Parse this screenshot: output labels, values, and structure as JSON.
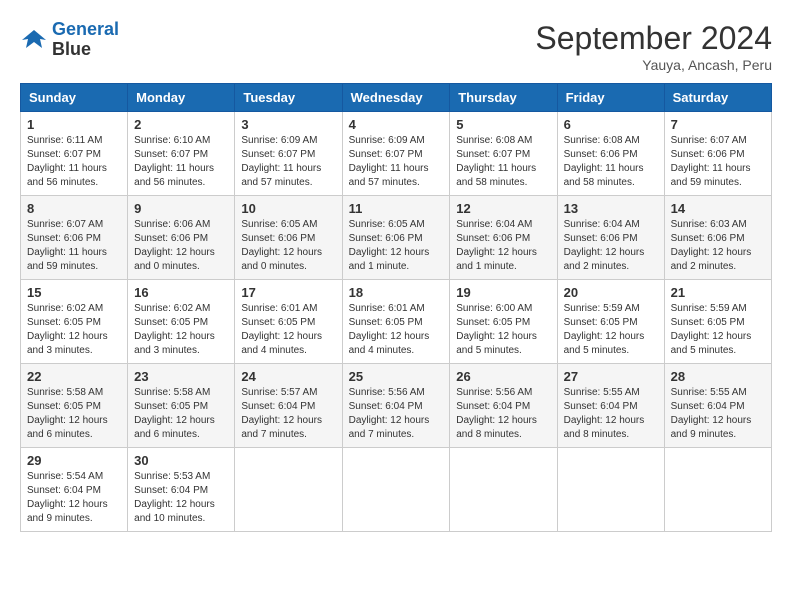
{
  "logo": {
    "line1": "General",
    "line2": "Blue"
  },
  "title": "September 2024",
  "location": "Yauya, Ancash, Peru",
  "days_of_week": [
    "Sunday",
    "Monday",
    "Tuesday",
    "Wednesday",
    "Thursday",
    "Friday",
    "Saturday"
  ],
  "weeks": [
    [
      {
        "day": "1",
        "sunrise": "6:11 AM",
        "sunset": "6:07 PM",
        "daylight": "11 hours and 56 minutes."
      },
      {
        "day": "2",
        "sunrise": "6:10 AM",
        "sunset": "6:07 PM",
        "daylight": "11 hours and 56 minutes."
      },
      {
        "day": "3",
        "sunrise": "6:09 AM",
        "sunset": "6:07 PM",
        "daylight": "11 hours and 57 minutes."
      },
      {
        "day": "4",
        "sunrise": "6:09 AM",
        "sunset": "6:07 PM",
        "daylight": "11 hours and 57 minutes."
      },
      {
        "day": "5",
        "sunrise": "6:08 AM",
        "sunset": "6:07 PM",
        "daylight": "11 hours and 58 minutes."
      },
      {
        "day": "6",
        "sunrise": "6:08 AM",
        "sunset": "6:06 PM",
        "daylight": "11 hours and 58 minutes."
      },
      {
        "day": "7",
        "sunrise": "6:07 AM",
        "sunset": "6:06 PM",
        "daylight": "11 hours and 59 minutes."
      }
    ],
    [
      {
        "day": "8",
        "sunrise": "6:07 AM",
        "sunset": "6:06 PM",
        "daylight": "11 hours and 59 minutes."
      },
      {
        "day": "9",
        "sunrise": "6:06 AM",
        "sunset": "6:06 PM",
        "daylight": "12 hours and 0 minutes."
      },
      {
        "day": "10",
        "sunrise": "6:05 AM",
        "sunset": "6:06 PM",
        "daylight": "12 hours and 0 minutes."
      },
      {
        "day": "11",
        "sunrise": "6:05 AM",
        "sunset": "6:06 PM",
        "daylight": "12 hours and 1 minute."
      },
      {
        "day": "12",
        "sunrise": "6:04 AM",
        "sunset": "6:06 PM",
        "daylight": "12 hours and 1 minute."
      },
      {
        "day": "13",
        "sunrise": "6:04 AM",
        "sunset": "6:06 PM",
        "daylight": "12 hours and 2 minutes."
      },
      {
        "day": "14",
        "sunrise": "6:03 AM",
        "sunset": "6:06 PM",
        "daylight": "12 hours and 2 minutes."
      }
    ],
    [
      {
        "day": "15",
        "sunrise": "6:02 AM",
        "sunset": "6:05 PM",
        "daylight": "12 hours and 3 minutes."
      },
      {
        "day": "16",
        "sunrise": "6:02 AM",
        "sunset": "6:05 PM",
        "daylight": "12 hours and 3 minutes."
      },
      {
        "day": "17",
        "sunrise": "6:01 AM",
        "sunset": "6:05 PM",
        "daylight": "12 hours and 4 minutes."
      },
      {
        "day": "18",
        "sunrise": "6:01 AM",
        "sunset": "6:05 PM",
        "daylight": "12 hours and 4 minutes."
      },
      {
        "day": "19",
        "sunrise": "6:00 AM",
        "sunset": "6:05 PM",
        "daylight": "12 hours and 5 minutes."
      },
      {
        "day": "20",
        "sunrise": "5:59 AM",
        "sunset": "6:05 PM",
        "daylight": "12 hours and 5 minutes."
      },
      {
        "day": "21",
        "sunrise": "5:59 AM",
        "sunset": "6:05 PM",
        "daylight": "12 hours and 5 minutes."
      }
    ],
    [
      {
        "day": "22",
        "sunrise": "5:58 AM",
        "sunset": "6:05 PM",
        "daylight": "12 hours and 6 minutes."
      },
      {
        "day": "23",
        "sunrise": "5:58 AM",
        "sunset": "6:05 PM",
        "daylight": "12 hours and 6 minutes."
      },
      {
        "day": "24",
        "sunrise": "5:57 AM",
        "sunset": "6:04 PM",
        "daylight": "12 hours and 7 minutes."
      },
      {
        "day": "25",
        "sunrise": "5:56 AM",
        "sunset": "6:04 PM",
        "daylight": "12 hours and 7 minutes."
      },
      {
        "day": "26",
        "sunrise": "5:56 AM",
        "sunset": "6:04 PM",
        "daylight": "12 hours and 8 minutes."
      },
      {
        "day": "27",
        "sunrise": "5:55 AM",
        "sunset": "6:04 PM",
        "daylight": "12 hours and 8 minutes."
      },
      {
        "day": "28",
        "sunrise": "5:55 AM",
        "sunset": "6:04 PM",
        "daylight": "12 hours and 9 minutes."
      }
    ],
    [
      {
        "day": "29",
        "sunrise": "5:54 AM",
        "sunset": "6:04 PM",
        "daylight": "12 hours and 9 minutes."
      },
      {
        "day": "30",
        "sunrise": "5:53 AM",
        "sunset": "6:04 PM",
        "daylight": "12 hours and 10 minutes."
      },
      null,
      null,
      null,
      null,
      null
    ]
  ]
}
